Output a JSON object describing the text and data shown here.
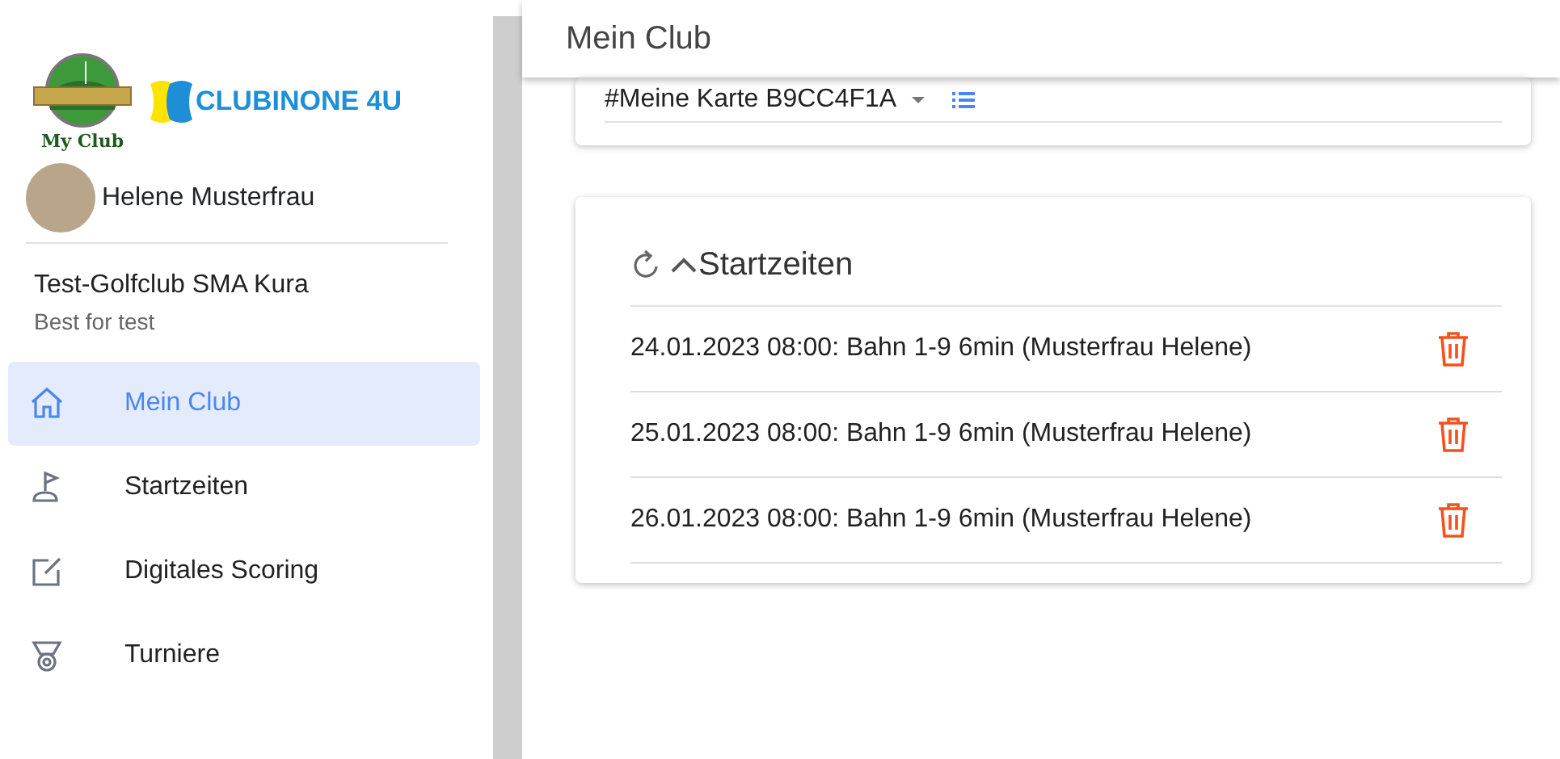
{
  "sidebar": {
    "logo_text": "My Club",
    "brand": "CLUBINONE 4U",
    "user": {
      "name": "Helene Musterfrau"
    },
    "club": {
      "name": "Test-Golfclub SMA Kura",
      "subtitle": "Best for test"
    },
    "items": [
      {
        "kind": "home",
        "label": "Mein Club",
        "selected": true
      },
      {
        "kind": "flag",
        "label": "Startzeiten",
        "selected": false
      },
      {
        "kind": "edit",
        "label": "Digitales Scoring",
        "selected": false
      },
      {
        "kind": "medal",
        "label": "Turniere",
        "selected": false
      }
    ]
  },
  "header": {
    "title": "Mein Club"
  },
  "card_card": {
    "label": "#Meine Karte B9CC4F1A"
  },
  "tee_times": {
    "title": "Startzeiten",
    "expanded": true,
    "rows": [
      {
        "text": "24.01.2023 08:00: Bahn 1-9 6min (Musterfrau Helene)"
      },
      {
        "text": "25.01.2023 08:00: Bahn 1-9 6min (Musterfrau Helene)"
      },
      {
        "text": "26.01.2023 08:00: Bahn 1-9 6min (Musterfrau Helene)"
      }
    ]
  }
}
